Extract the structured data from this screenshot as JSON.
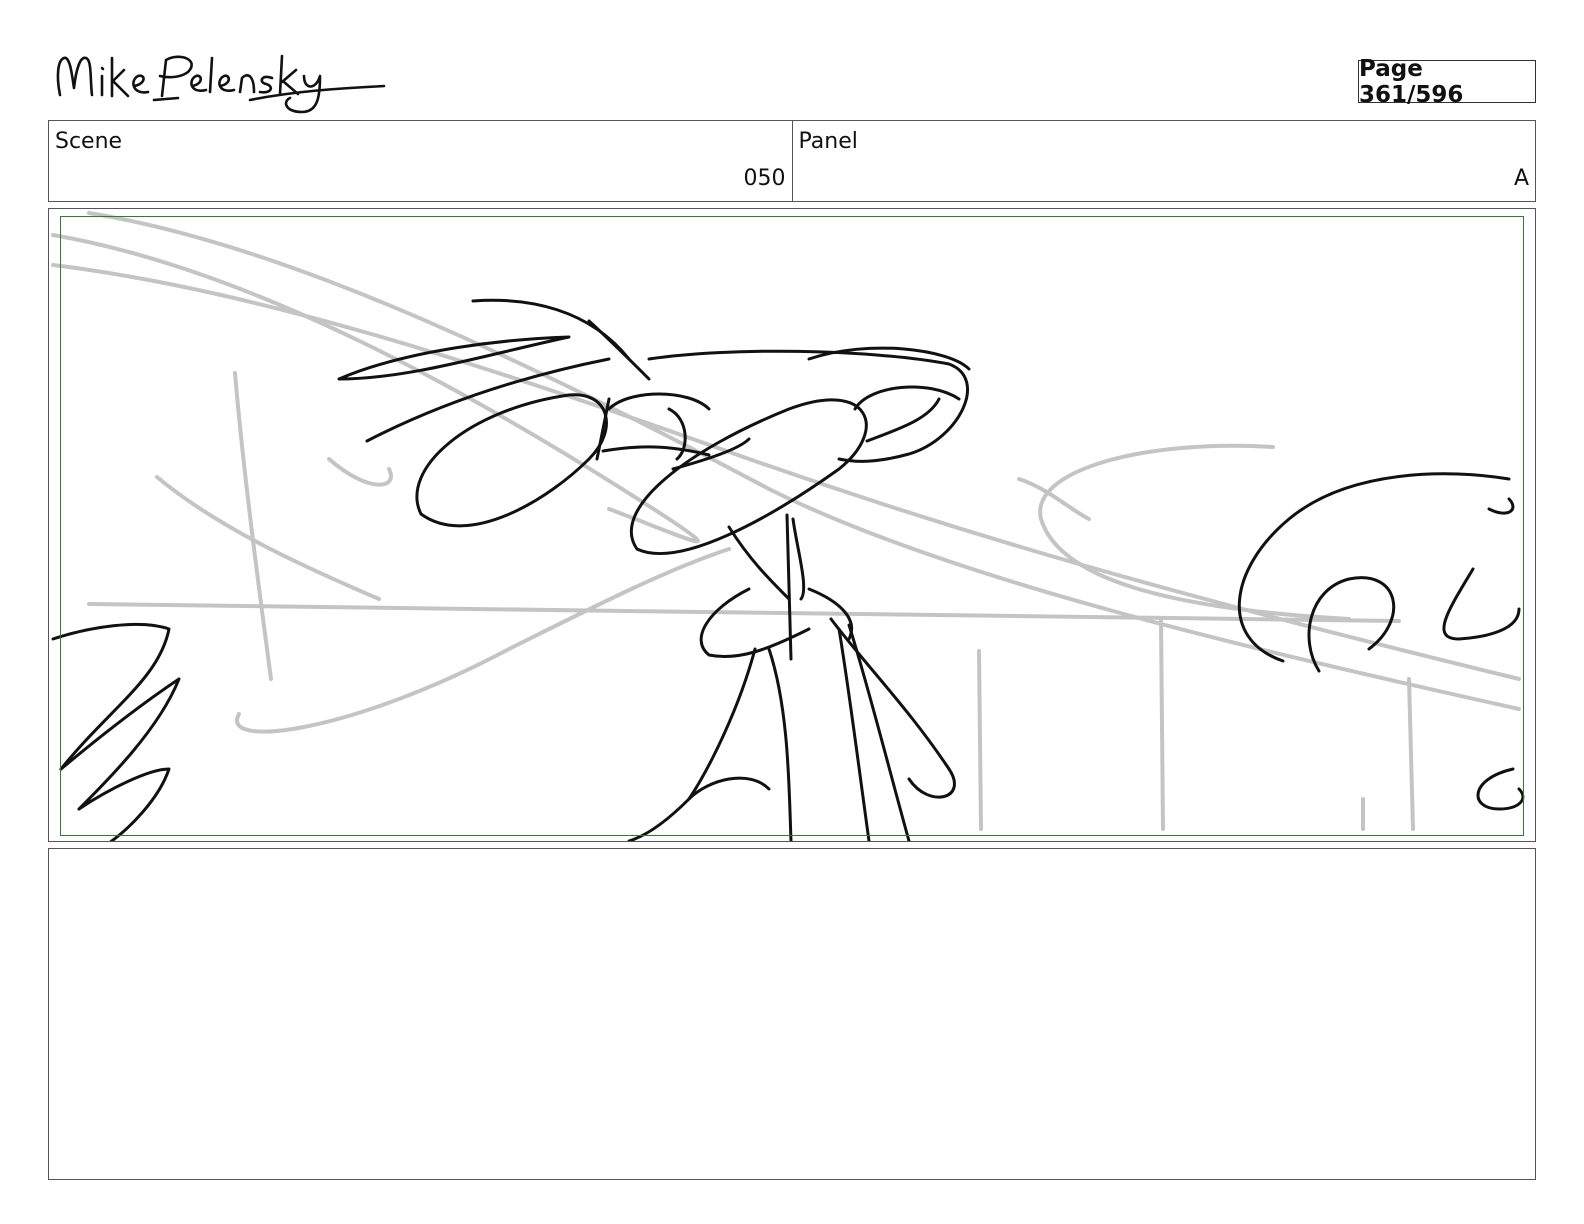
{
  "header": {
    "signature_text": "Mike Pelensky",
    "page_label": "Page 361/596"
  },
  "info": {
    "scene_label": "Scene",
    "scene_value": "050",
    "panel_label": "Panel",
    "panel_value": "A"
  },
  "colors": {
    "safe_area_border": "#2e7d32",
    "sketch_line": "#111111",
    "construction_line": "#c4c4c4"
  },
  "notes": {
    "text": ""
  }
}
